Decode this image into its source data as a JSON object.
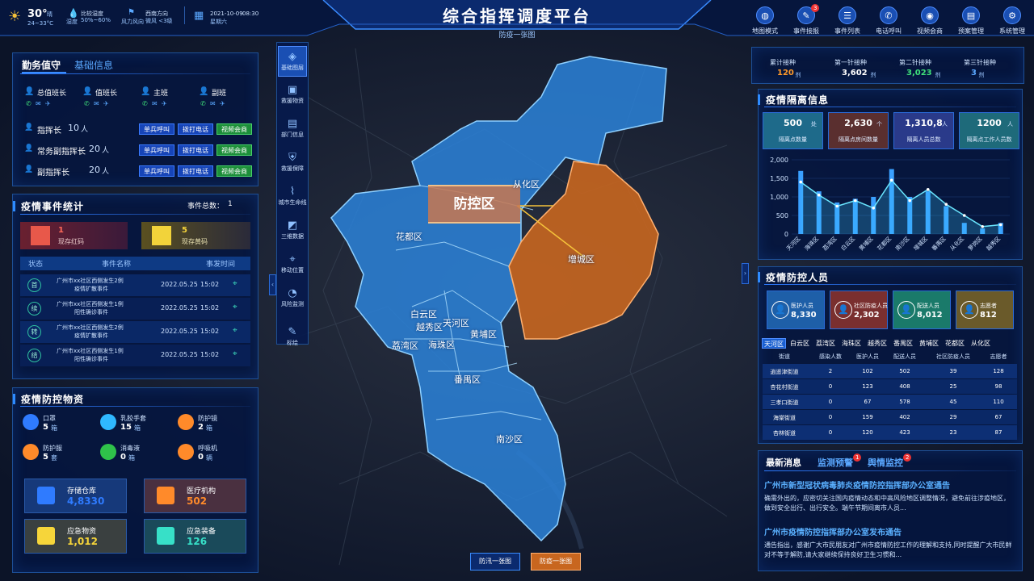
{
  "header": {
    "title": "综合指挥调度平台",
    "subtitle": "防疫一张图",
    "weather": {
      "temp": "30°",
      "temp_unit": "晴",
      "temp_range": "24~33°C",
      "humidity_label": "比较湿度",
      "humidity_value": "50%~60%",
      "humidity_sub": "湿度",
      "wind_label": "风力风向",
      "wind_value": "西南方向",
      "wind_sub": "微风 <3级",
      "date": "2021-10-09",
      "time": "08:30",
      "weekday": "星期六"
    },
    "nav": [
      {
        "label": "地图模式",
        "icon": "globe-icon"
      },
      {
        "label": "事件接报",
        "icon": "report-icon",
        "badge": "3"
      },
      {
        "label": "事件列表",
        "icon": "list-icon"
      },
      {
        "label": "电话呼叫",
        "icon": "phone-icon"
      },
      {
        "label": "视频会商",
        "icon": "video-icon"
      },
      {
        "label": "预案管理",
        "icon": "plan-icon"
      },
      {
        "label": "系统管理",
        "icon": "system-icon"
      }
    ]
  },
  "duty": {
    "tab_active": "勤务值守",
    "tab_other": "基础信息",
    "roles": [
      "总值班长",
      "值班长",
      "主班",
      "副班"
    ],
    "rows": [
      {
        "label": "指挥长",
        "count": "10",
        "unit": "人"
      },
      {
        "label": "常务副指挥长",
        "count": "20",
        "unit": "人"
      },
      {
        "label": "副指挥长",
        "count": "20",
        "unit": "人"
      }
    ],
    "btn1": "单兵呼叫",
    "btn2": "拨打电话",
    "btn3": "视频会商"
  },
  "events": {
    "title": "疫情事件统计",
    "total_label": "事件总数：",
    "total": "1",
    "red_count": "1",
    "red_label": "现存红码",
    "yellow_count": "5",
    "yellow_label": "现存黄码",
    "headers": [
      "状态",
      "事件名称",
      "事发时间"
    ],
    "rows": [
      {
        "status": "首",
        "name1": "广州市xx社区西侧发生2例",
        "name2": "疫情扩散事件",
        "date": "2022.05.25",
        "time": "15:02"
      },
      {
        "status": "续",
        "name1": "广州市xx社区西侧发生1例",
        "name2": "阳性确诊事件",
        "date": "2022.05.25",
        "time": "15:02"
      },
      {
        "status": "转",
        "name1": "广州市xx社区西侧发生2例",
        "name2": "疫情扩散事件",
        "date": "2022.05.25",
        "time": "15:02"
      },
      {
        "status": "结",
        "name1": "广州市xx社区西侧发生1例",
        "name2": "阳性确诊事件",
        "date": "2022.05.25",
        "time": "15:02"
      }
    ]
  },
  "supplies": {
    "title": "疫情防控物资",
    "items": [
      {
        "name": "口罩",
        "value": "5",
        "unit": "箱",
        "color": "#2f7bff"
      },
      {
        "name": "乳胶手套",
        "value": "15",
        "unit": "箱",
        "color": "#2fb8ff"
      },
      {
        "name": "防护镜",
        "value": "2",
        "unit": "箱",
        "color": "#ff8a2a"
      },
      {
        "name": "防护服",
        "value": "5",
        "unit": "套",
        "color": "#ff8a2a"
      },
      {
        "name": "消毒液",
        "value": "0",
        "unit": "箱",
        "color": "#2fc24a"
      },
      {
        "name": "呼吸机",
        "value": "0",
        "unit": "辆",
        "color": "#ff8a2a"
      }
    ],
    "cards": [
      {
        "name": "存储仓库",
        "value": "4,8330",
        "color": "#2f7bff"
      },
      {
        "name": "医疗机构",
        "value": "502",
        "color": "#ff8a2a"
      },
      {
        "name": "应急物资",
        "value": "1,012",
        "color": "#f6d53a"
      },
      {
        "name": "应急装备",
        "value": "126",
        "color": "#37e0c8"
      }
    ]
  },
  "sidebar": [
    {
      "label": "基础图层",
      "icon": "layers-icon"
    },
    {
      "label": "救援物资",
      "icon": "box-icon"
    },
    {
      "label": "部门信息",
      "icon": "dept-icon"
    },
    {
      "label": "救援保障",
      "icon": "shield-icon"
    },
    {
      "label": "城市生命线",
      "icon": "lifeline-icon"
    },
    {
      "label": "三维数据",
      "icon": "cube-icon"
    },
    {
      "label": "移动位置",
      "icon": "location-icon"
    },
    {
      "label": "风险监测",
      "icon": "monitor-icon"
    },
    {
      "label": "标绘",
      "icon": "draw-icon"
    }
  ],
  "map": {
    "callout": "防控区",
    "districts": [
      "从化区",
      "花都区",
      "增城区",
      "白云区",
      "越秀区",
      "天河区",
      "黄埔区",
      "荔湾区",
      "海珠区",
      "番禺区",
      "南沙区"
    ],
    "bottom_tabs": [
      "防汛一张图",
      "防疫一张图"
    ]
  },
  "vaccination": [
    {
      "label": "累计接种",
      "value": "120",
      "unit": "剂",
      "color": "#ff9a2a"
    },
    {
      "label": "第一针接种",
      "value": "3,602",
      "unit": "剂",
      "color": "#ffffff"
    },
    {
      "label": "第二针接种",
      "value": "3,023",
      "unit": "剂",
      "color": "#3fe07a"
    },
    {
      "label": "第三针接种",
      "value": "3",
      "unit": "剂",
      "color": "#5aa8ff"
    }
  ],
  "quarantine": {
    "title": "疫情隔离信息",
    "cards": [
      {
        "value": "500",
        "unit": "处",
        "label": "隔离点数量",
        "color": "#1e6a8a"
      },
      {
        "value": "2,630",
        "unit": "个",
        "label": "隔离点房间数量",
        "color": "#5a2f2f"
      },
      {
        "value": "1,310,8",
        "unit": "人",
        "label": "隔离人员总数",
        "color": "#2a3a8a"
      },
      {
        "value": "1200",
        "unit": "人",
        "label": "隔离点工作人员数",
        "color": "#1e6a7a"
      }
    ]
  },
  "chart_data": {
    "type": "bar",
    "categories": [
      "天河区",
      "海珠区",
      "荔湾区",
      "白云区",
      "黄埔区",
      "花都区",
      "南沙区",
      "增城区",
      "番禺区",
      "从化区",
      "萝岗区",
      "越秀区"
    ],
    "values": [
      1700,
      1150,
      850,
      950,
      1000,
      1750,
      1000,
      1150,
      750,
      300,
      150,
      300
    ],
    "line_values": [
      1400,
      1050,
      750,
      900,
      700,
      1450,
      900,
      1200,
      800,
      500,
      200,
      250
    ],
    "ylim": [
      0,
      2000
    ],
    "yticks": [
      "0",
      "500",
      "1,000",
      "1,500",
      "2,000"
    ]
  },
  "personnel": {
    "title": "疫情防控人员",
    "cards": [
      {
        "label": "医护人员",
        "value": "8,330",
        "color": "#1e5fa8"
      },
      {
        "label": "社区防疫人员",
        "value": "2,302",
        "color": "#7a2f2f"
      },
      {
        "label": "配送人员",
        "value": "8,012",
        "color": "#1a7a6a"
      },
      {
        "label": "志愿者",
        "value": "812",
        "color": "#6a5a2a"
      }
    ],
    "tabs": [
      "天河区",
      "白云区",
      "荔湾区",
      "海珠区",
      "越秀区",
      "番禺区",
      "黄埔区",
      "花都区",
      "从化区"
    ],
    "headers": [
      "街道",
      "感染人数",
      "医护人员",
      "配送人员",
      "社区防疫人员",
      "志愿者"
    ],
    "rows": [
      [
        "逍遥津街道",
        "2",
        "102",
        "502",
        "39",
        "128"
      ],
      [
        "杏花村街道",
        "0",
        "123",
        "408",
        "25",
        "98"
      ],
      [
        "三孝口街道",
        "0",
        "67",
        "578",
        "45",
        "110"
      ],
      [
        "海棠街道",
        "0",
        "159",
        "402",
        "29",
        "67"
      ],
      [
        "杏林街道",
        "0",
        "120",
        "423",
        "23",
        "87"
      ]
    ]
  },
  "news": {
    "tabs": [
      {
        "label": "最新消息",
        "badge": ""
      },
      {
        "label": "监测预警",
        "badge": "1"
      },
      {
        "label": "舆情监控",
        "badge": "2"
      }
    ],
    "items": [
      {
        "title": "广州市新型冠状病毒肺炎疫情防控指挥部办公室通告",
        "text1": "确需外出的，应密切关注国内疫情动态和中高风险地区调整情况，避免前往涉疫地区，",
        "text2": "做到安全出行、出行安全。端午节期间离市人员..."
      },
      {
        "title": "广州市疫情防控指挥部办公室发布通告",
        "text1": "通告指出，感谢广大市民朋友对广州市疫情防控工作的理解和支持,同时提醒广大市民鲜",
        "text2": "对不等于解防,请大家继续保持良好卫生习惯和..."
      }
    ]
  }
}
